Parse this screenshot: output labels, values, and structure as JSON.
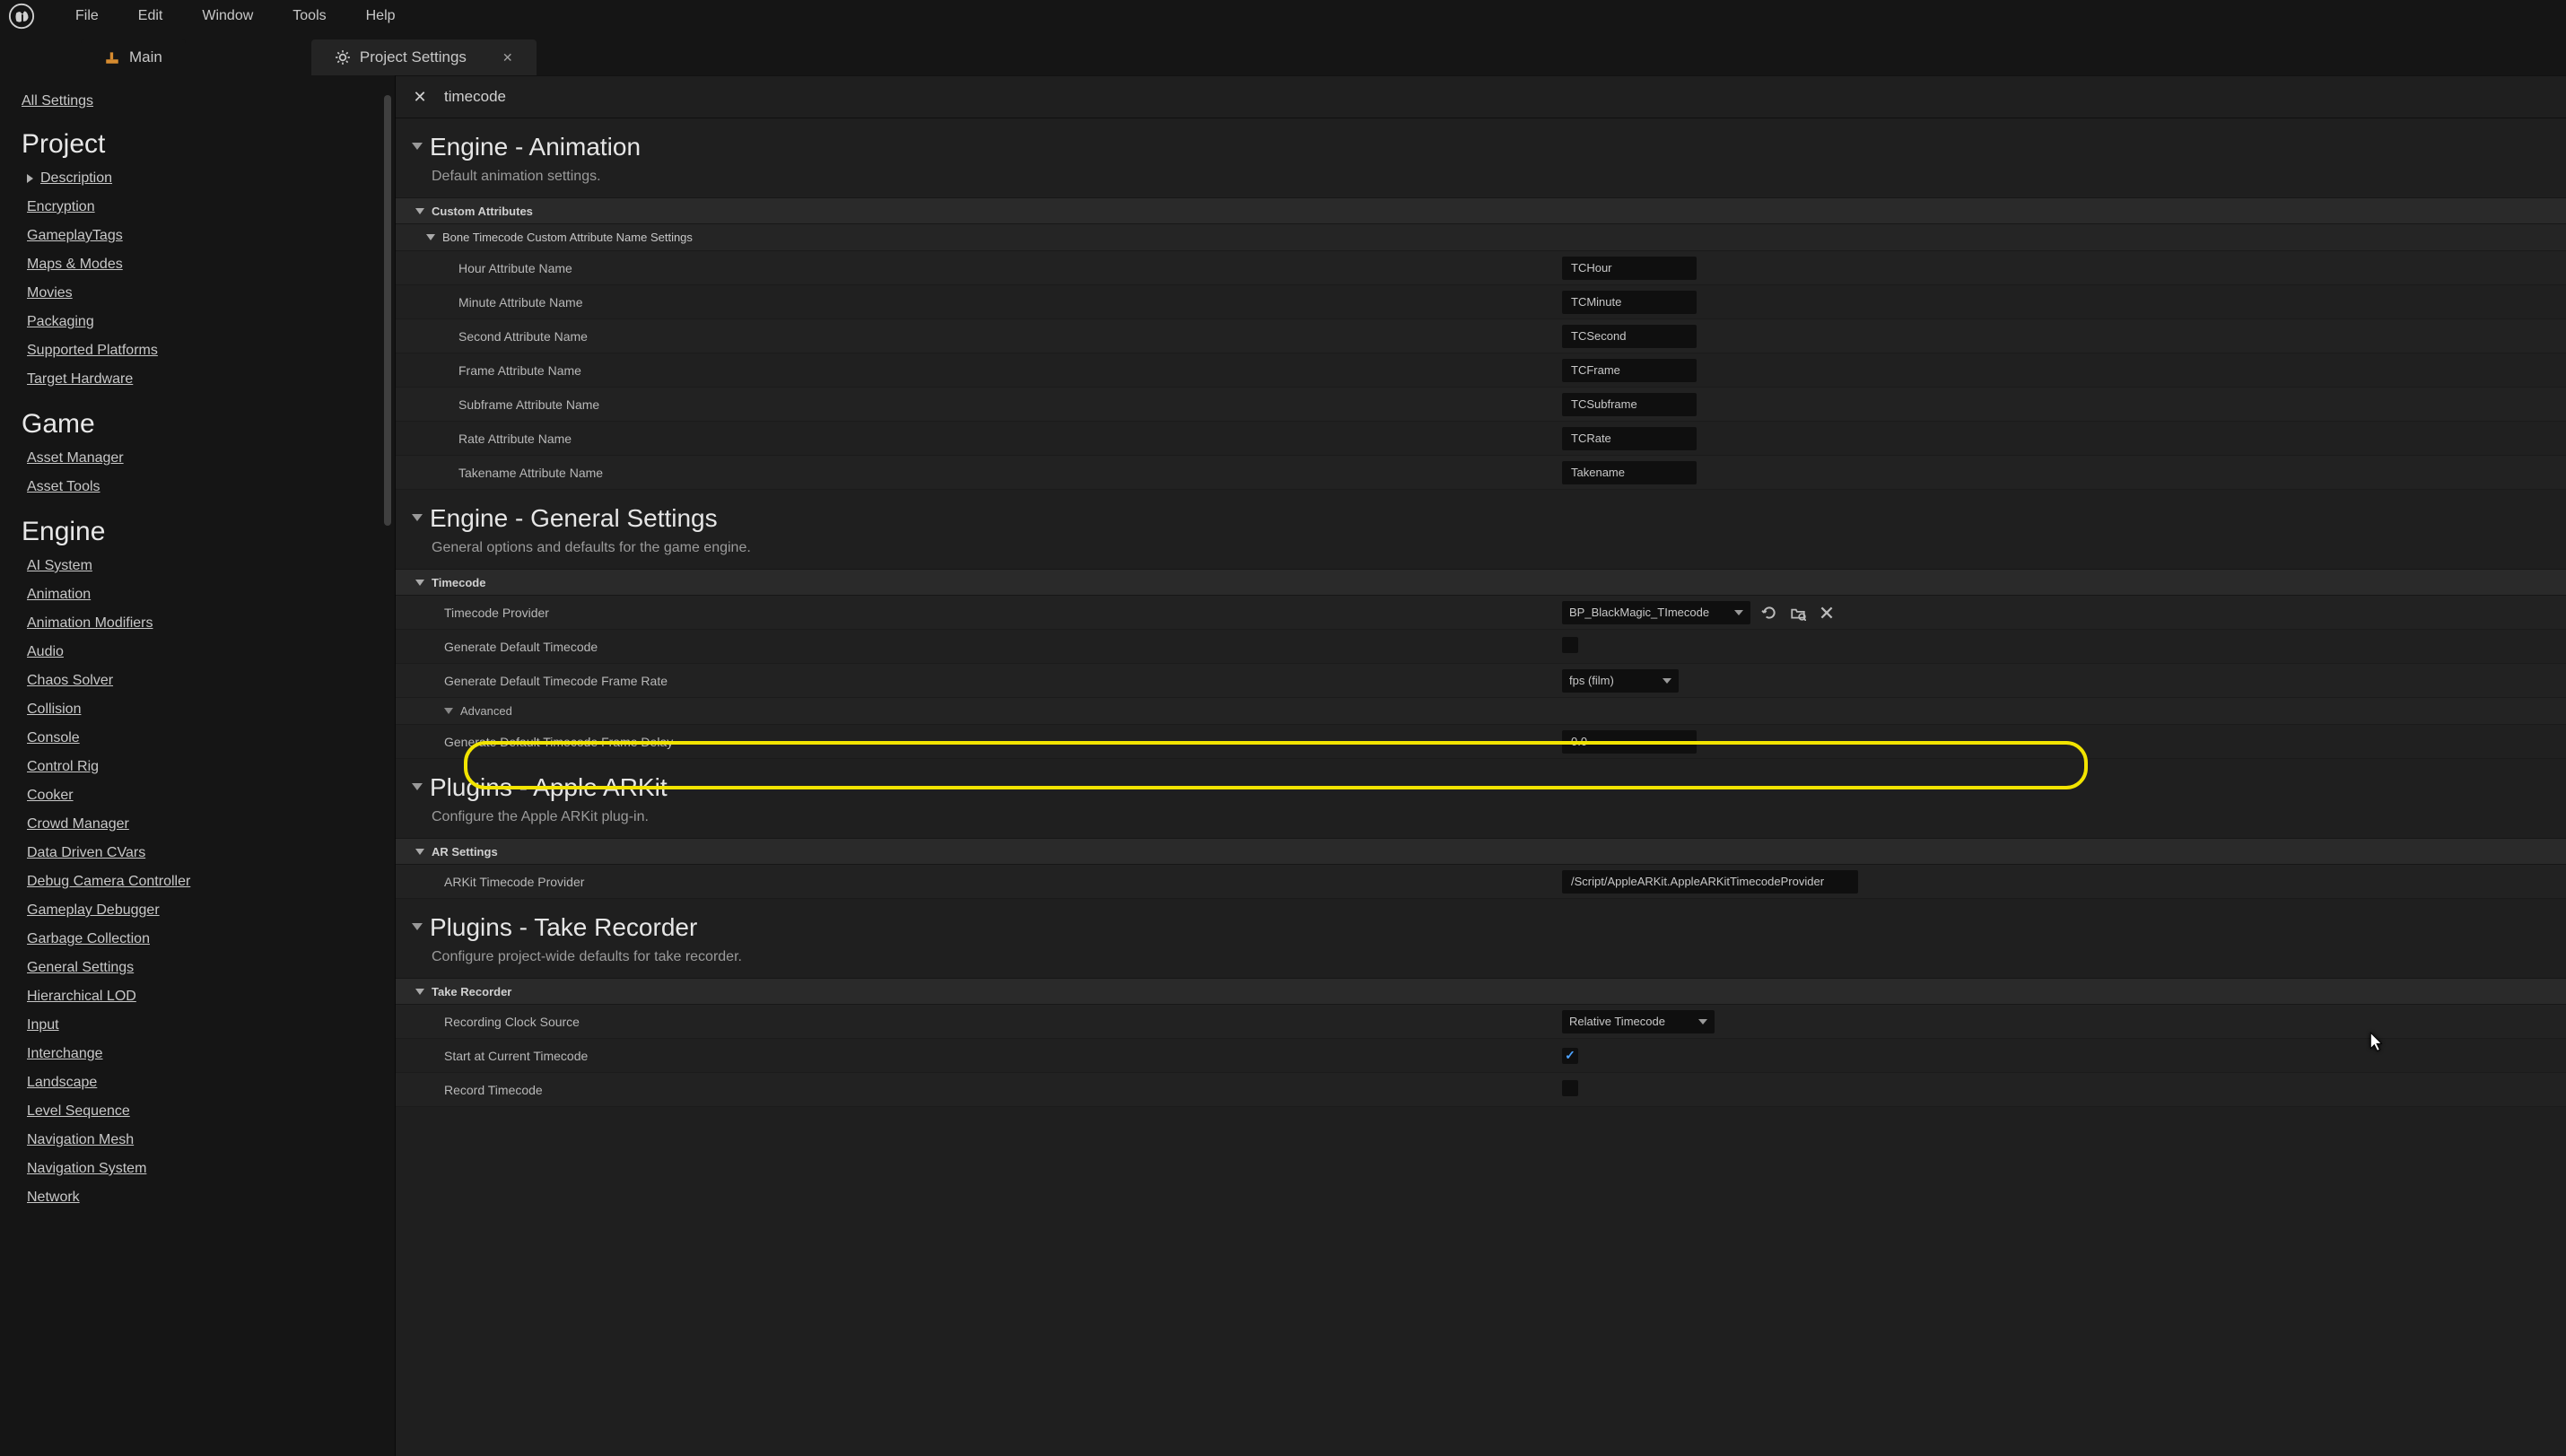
{
  "menubar": [
    "File",
    "Edit",
    "Window",
    "Tools",
    "Help"
  ],
  "tabs": {
    "main": "Main",
    "settings": "Project Settings"
  },
  "sidebar": {
    "all": "All Settings",
    "sections": [
      {
        "title": "Project",
        "links": [
          "Description",
          "Encryption",
          "GameplayTags",
          "Maps & Modes",
          "Movies",
          "Packaging",
          "Supported Platforms",
          "Target Hardware"
        ],
        "first_has_caret": true
      },
      {
        "title": "Game",
        "links": [
          "Asset Manager",
          "Asset Tools"
        ]
      },
      {
        "title": "Engine",
        "links": [
          "AI System",
          "Animation",
          "Animation Modifiers",
          "Audio",
          "Chaos Solver",
          "Collision",
          "Console",
          "Control Rig",
          "Cooker",
          "Crowd Manager",
          "Data Driven CVars",
          "Debug Camera Controller",
          "Gameplay Debugger",
          "Garbage Collection",
          "General Settings",
          "Hierarchical LOD",
          "Input",
          "Interchange",
          "Landscape",
          "Level Sequence",
          "Navigation Mesh",
          "Navigation System",
          "Network"
        ]
      }
    ]
  },
  "search": {
    "value": "timecode"
  },
  "anim": {
    "title": "Engine - Animation",
    "subtitle": "Default animation settings.",
    "group": "Custom Attributes",
    "subgroup": "Bone Timecode Custom Attribute Name Settings",
    "rows": [
      {
        "label": "Hour Attribute Name",
        "value": "TCHour"
      },
      {
        "label": "Minute Attribute Name",
        "value": "TCMinute"
      },
      {
        "label": "Second Attribute Name",
        "value": "TCSecond"
      },
      {
        "label": "Frame Attribute Name",
        "value": "TCFrame"
      },
      {
        "label": "Subframe Attribute Name",
        "value": "TCSubframe"
      },
      {
        "label": "Rate Attribute Name",
        "value": "TCRate"
      },
      {
        "label": "Takename Attribute Name",
        "value": "Takename"
      }
    ]
  },
  "general": {
    "title": "Engine - General Settings",
    "subtitle": "General options and defaults for the game engine.",
    "group": "Timecode",
    "provider_label": "Timecode Provider",
    "provider_value": "BP_BlackMagic_TImecode",
    "gen_default_label": "Generate Default Timecode",
    "gen_rate_label": "Generate Default Timecode Frame Rate",
    "gen_rate_value": "fps (film)",
    "adv": "Advanced",
    "delay_label": "Generate Default Timecode Frame Delay",
    "delay_value": "0.0"
  },
  "arkit": {
    "title": "Plugins - Apple ARKit",
    "subtitle": "Configure the Apple ARKit plug-in.",
    "group": "AR Settings",
    "row_label": "ARKit Timecode Provider",
    "row_value": "/Script/AppleARKit.AppleARKitTimecodeProvider"
  },
  "take": {
    "title": "Plugins - Take Recorder",
    "subtitle": "Configure project-wide defaults for take recorder.",
    "group": "Take Recorder",
    "clock_label": "Recording Clock Source",
    "clock_value": "Relative Timecode",
    "start_label": "Start at Current Timecode",
    "record_label": "Record Timecode"
  }
}
